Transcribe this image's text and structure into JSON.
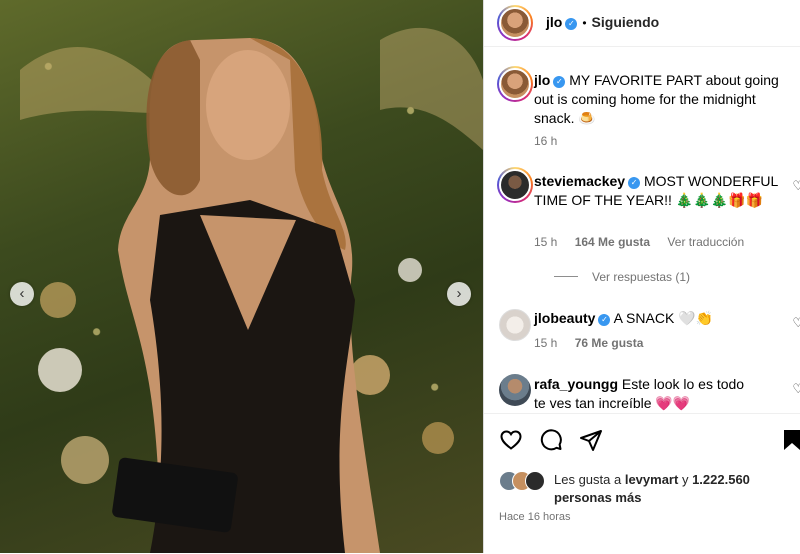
{
  "header": {
    "username": "jlo",
    "separator": "•",
    "follow_status": "Siguiendo"
  },
  "caption": {
    "username": "jlo",
    "text": "MY FAVORITE PART about going out is coming home for the midnight snack. 🍮",
    "time": "16 h"
  },
  "comments": [
    {
      "username": "steviemackey",
      "text": "MOST WONDERFUL TIME OF THE YEAR!! 🎄🎄🎄🎁🎁",
      "time": "15 h",
      "likes": "164 Me gusta",
      "translate": "Ver traducción",
      "replies": "Ver respuestas (1)"
    },
    {
      "username": "jlobeauty",
      "text": "A SNACK 🤍👏",
      "time": "15 h",
      "likes": "76 Me gusta"
    },
    {
      "username": "rafa_youngg",
      "text": "Este look lo es todo te ves tan increíble 💗💗"
    }
  ],
  "likes_summary": {
    "prefix": "Les gusta a",
    "user": "levymart",
    "middle": "y",
    "count": "1.222.560",
    "suffix": "personas más"
  },
  "post_time": "Hace 16 horas",
  "icons": {
    "verified": "verified-badge-icon",
    "like": "heart-icon",
    "comment": "comment-bubble-icon",
    "share": "paper-plane-icon",
    "save": "bookmark-icon",
    "prev": "chevron-left-icon",
    "next": "chevron-right-icon"
  },
  "colors": {
    "verified": "#3897f0",
    "meta_text": "#737373",
    "border": "#dbdbdb"
  }
}
